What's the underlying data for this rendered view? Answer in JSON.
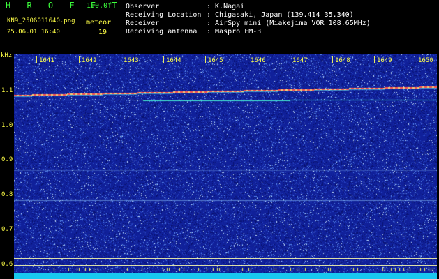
{
  "header": {
    "app_title": "H R O F F T",
    "version": "1.0.0f",
    "filename": "KN9_2506011640.png",
    "mode": "meteor",
    "datetime": "25.06.01 16:40",
    "count": "19",
    "observer_label": "Observer",
    "observer_value": ": K.Nagai",
    "location_label": "Receiving Location",
    "location_value": ": Chigasaki, Japan (139.414 35.340)",
    "receiver_label": "Receiver",
    "receiver_value": ": AirSpy mini (Miakejima VOR 108.65MHz)",
    "antenna_label": "Receiving antenna",
    "antenna_value": ": Maspro FM-3"
  },
  "spectrogram": {
    "unit": "kHz",
    "freq_ticks": [
      "1.1",
      "1.0",
      "0.9",
      "0.8",
      "0.7",
      "0.6"
    ],
    "time_ticks": [
      "1641",
      "1642",
      "1643",
      "1644",
      "1645",
      "1646",
      "1647",
      "1648",
      "1649",
      "1650"
    ],
    "background_color": "#10209a",
    "trace_color": "#ff5050",
    "floor_color": "#18c8f0"
  }
}
